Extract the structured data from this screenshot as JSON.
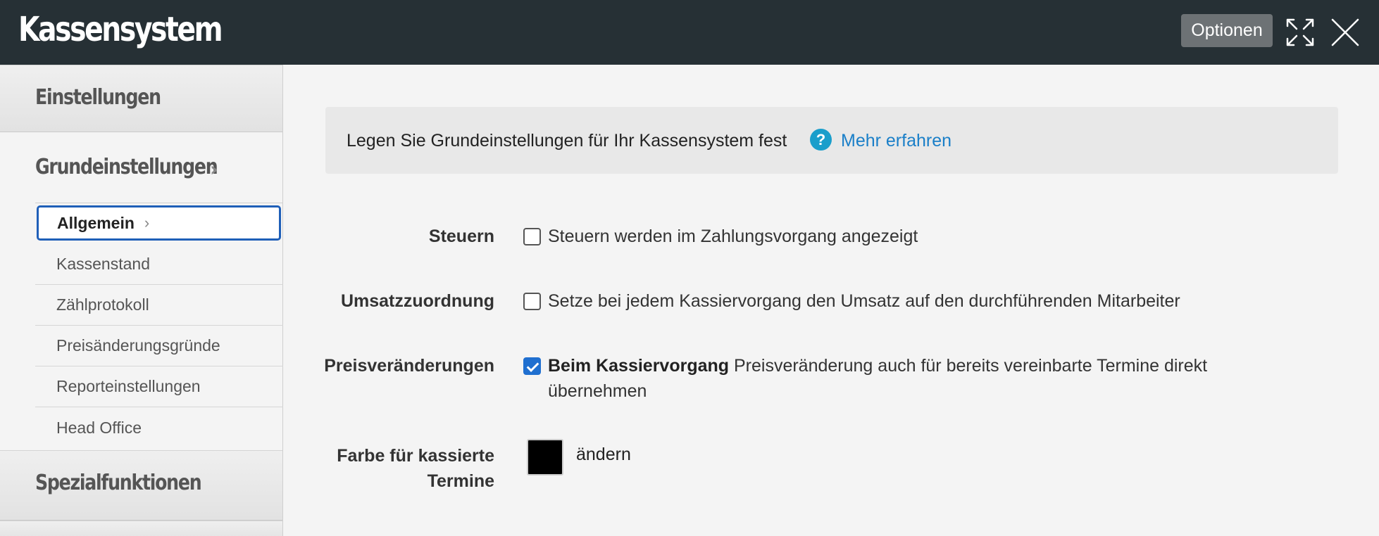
{
  "window": {
    "title": "Kassensystem",
    "options_label": "Optionen",
    "expand_icon": "expand-icon",
    "close_icon": "close-icon"
  },
  "sidebar": {
    "section1": "Einstellungen",
    "subsection": "Grundeinstellungen",
    "items": [
      {
        "label": "Allgemein",
        "active": true
      },
      {
        "label": "Kassenstand"
      },
      {
        "label": "Zählprotokoll"
      },
      {
        "label": "Preisänderungsgründe"
      },
      {
        "label": "Reporteinstellungen"
      },
      {
        "label": "Head Office"
      }
    ],
    "section2": "Spezialfunktionen"
  },
  "info": {
    "text": "Legen Sie Grundeinstellungen für Ihr Kassensystem fest",
    "help_icon": "question-icon",
    "link": "Mehr erfahren"
  },
  "settings": {
    "steuern": {
      "label": "Steuern",
      "text": "Steuern werden im Zahlungsvorgang angezeigt",
      "checked": false
    },
    "umsatz": {
      "label": "Umsatzzuordnung",
      "text": "Setze bei jedem Kassiervorgang den Umsatz auf den durchführenden Mitarbeiter",
      "checked": false
    },
    "preis": {
      "label": "Preisveränderungen",
      "bold": "Beim Kassiervorgang",
      "text_line1": "Preisveränderung auch für bereits vereinbarte Termine direkt",
      "text_line2": "übernehmen",
      "checked": true
    },
    "farbe": {
      "label_line1": "Farbe für kassierte",
      "label_line2": "Termine",
      "color": "#000000",
      "change": "ändern"
    }
  },
  "colors": {
    "titlebar": "#263035",
    "accent": "#1f6fd0",
    "link": "#1a7fc8"
  }
}
